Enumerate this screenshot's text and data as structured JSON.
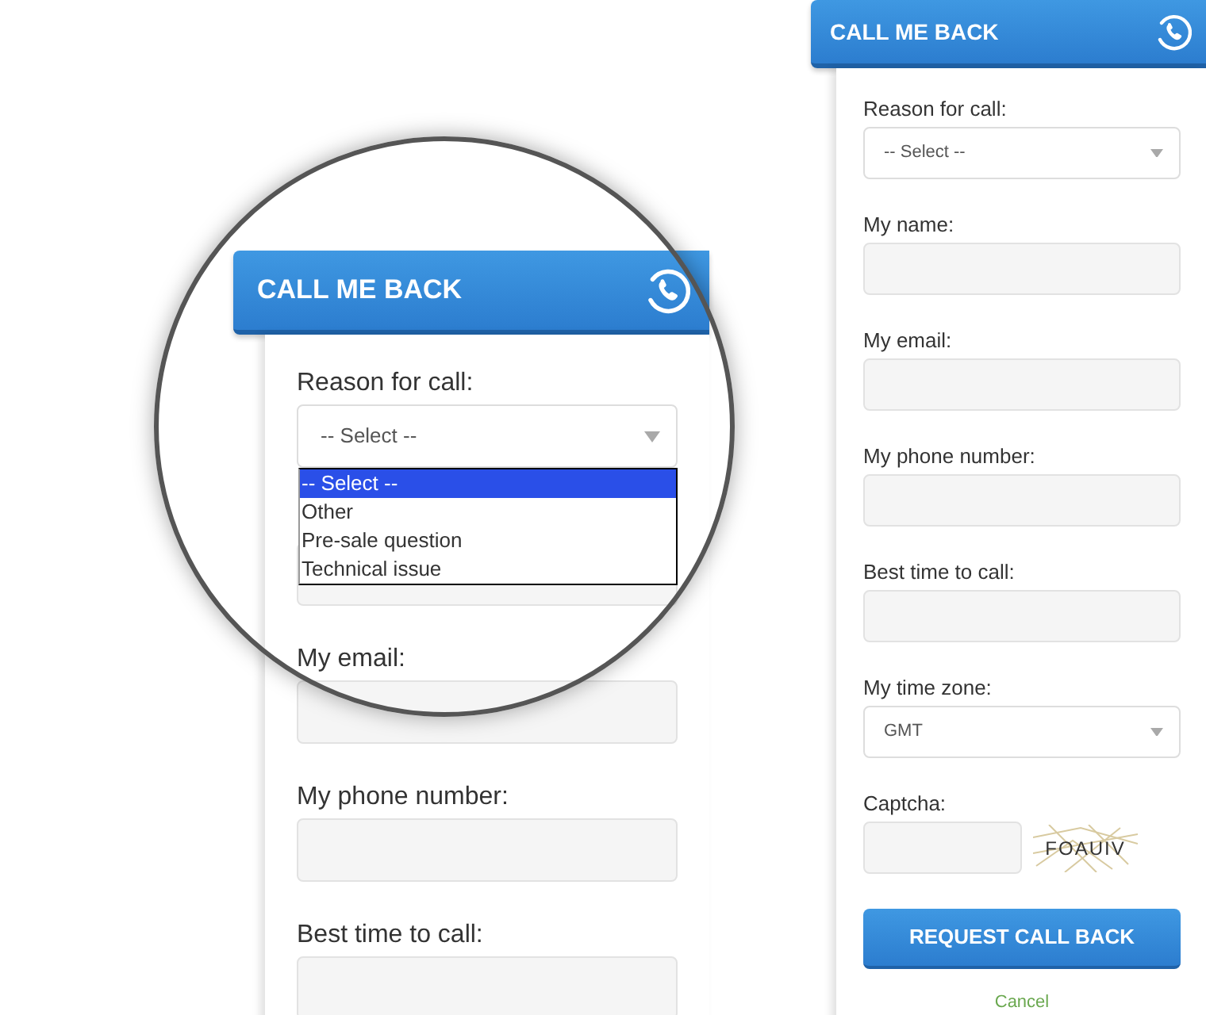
{
  "magnified_view": {
    "title": "CALL ME BACK",
    "fields": [
      {
        "kind": "select",
        "label": "Reason for call:",
        "value": "-- Select --",
        "open": true,
        "options": [
          {
            "label": "-- Select --",
            "selected": true
          },
          {
            "label": "Other",
            "selected": false
          },
          {
            "label": "Pre-sale question",
            "selected": false
          },
          {
            "label": "Technical issue",
            "selected": false
          }
        ]
      },
      {
        "kind": "text"
      },
      {
        "kind": "text",
        "label": "My email:"
      },
      {
        "kind": "text",
        "label": "My phone number:"
      },
      {
        "kind": "text",
        "label": "Best time to call:"
      }
    ]
  },
  "widget": {
    "title": "CALL ME BACK",
    "fields": [
      {
        "kind": "select",
        "label": "Reason for call:",
        "value": "-- Select --"
      },
      {
        "kind": "text",
        "label": "My name:"
      },
      {
        "kind": "text",
        "label": "My email:"
      },
      {
        "kind": "text",
        "label": "My phone number:"
      },
      {
        "kind": "text",
        "label": "Best time to call:"
      },
      {
        "kind": "select",
        "label": "My time zone:",
        "value": "GMT"
      },
      {
        "kind": "captcha",
        "label": "Captcha:",
        "captcha_text": "FOAUIV"
      }
    ],
    "submit_button": "REQUEST CALL BACK",
    "cancel_link": "Cancel"
  }
}
